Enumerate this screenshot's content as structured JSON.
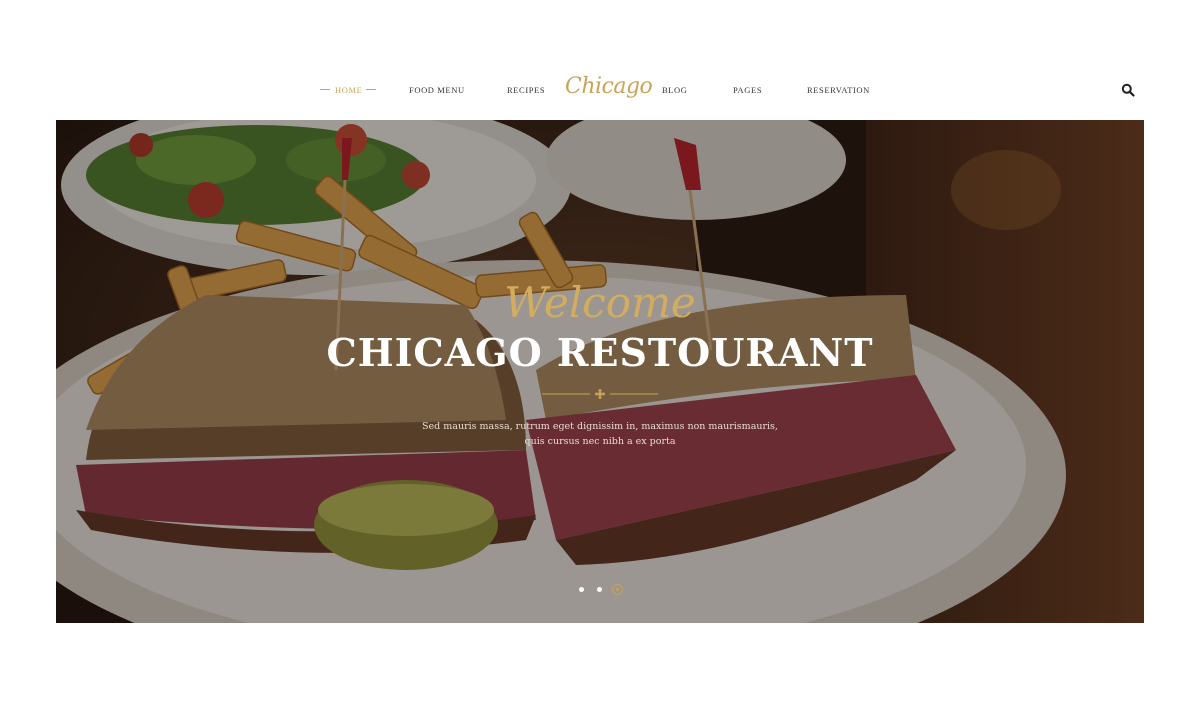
{
  "nav": {
    "items": [
      {
        "label": "HOME",
        "active": true
      },
      {
        "label": "FOOD MENU"
      },
      {
        "label": "RECIPES"
      },
      {
        "label": "BLOG"
      },
      {
        "label": "PAGES"
      },
      {
        "label": "RESERVATION"
      }
    ],
    "logo": "Chicago",
    "search_icon": "search-icon"
  },
  "hero": {
    "script_title": "Welcome",
    "title": "CHICAGO RESTOURANT",
    "description": "Sed mauris massa, rutrum eget dignissim in, maximus non maurismauris, quis cursus nec nibh a ex porta",
    "divider_icon": "flower-icon",
    "slider": {
      "count": 3,
      "active": 3
    }
  },
  "colors": {
    "accent": "#c9a35a",
    "text": "#333333",
    "white": "#ffffff"
  }
}
